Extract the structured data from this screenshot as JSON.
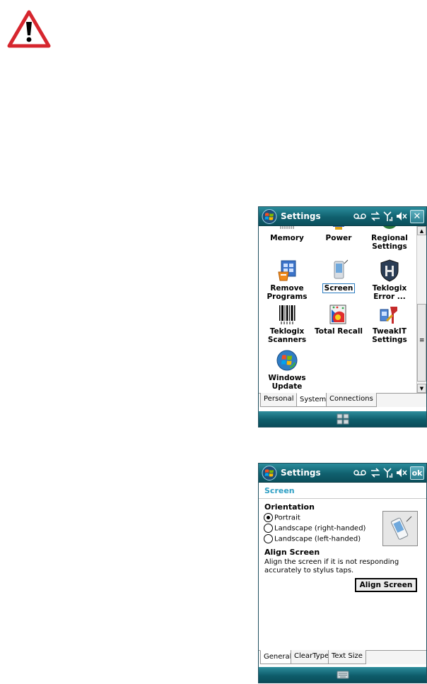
{
  "warning": {
    "icon": "warning-exclamation-icon"
  },
  "screen1": {
    "title": "Settings",
    "close_label": "✕",
    "items": [
      {
        "label": "Memory",
        "icon": "memory-icon"
      },
      {
        "label": "Power",
        "icon": "power-icon"
      },
      {
        "label": "Regional Settings",
        "icon": "globe-icon"
      },
      {
        "label": "Remove Programs",
        "icon": "remove-programs-icon"
      },
      {
        "label": "Screen",
        "icon": "screen-icon"
      },
      {
        "label": "Teklogix Error ...",
        "icon": "teklogix-error-icon"
      },
      {
        "label": "Teklogix Scanners",
        "icon": "barcode-icon"
      },
      {
        "label": "Total Recall",
        "icon": "total-recall-icon"
      },
      {
        "label": "TweakIT Settings",
        "icon": "tweakit-icon"
      },
      {
        "label": "Windows Update",
        "icon": "windows-update-icon"
      }
    ],
    "tabs": [
      "Personal",
      "System",
      "Connections"
    ],
    "active_tab": "System",
    "bottom_icon": "grid-menu-icon",
    "scroll_up": "▲",
    "scroll_down": "▼",
    "scroll_grip": "≡"
  },
  "screen2": {
    "title": "Settings",
    "ok_label": "ok",
    "heading": "Screen",
    "orientation_label": "Orientation",
    "orientations": [
      "Portrait",
      "Landscape (right-handed)",
      "Landscape (left-handed)"
    ],
    "selected_orientation": "Portrait",
    "align_label": "Align Screen",
    "align_desc": "Align the screen if it is not responding accurately to stylus taps.",
    "align_button": "Align Screen",
    "tabs": [
      "General",
      "ClearType",
      "Text Size"
    ],
    "active_tab": "General",
    "bottom_icon": "keyboard-icon"
  },
  "colors": {
    "titlebar": "#10606e",
    "heading": "#2d9fc4"
  }
}
